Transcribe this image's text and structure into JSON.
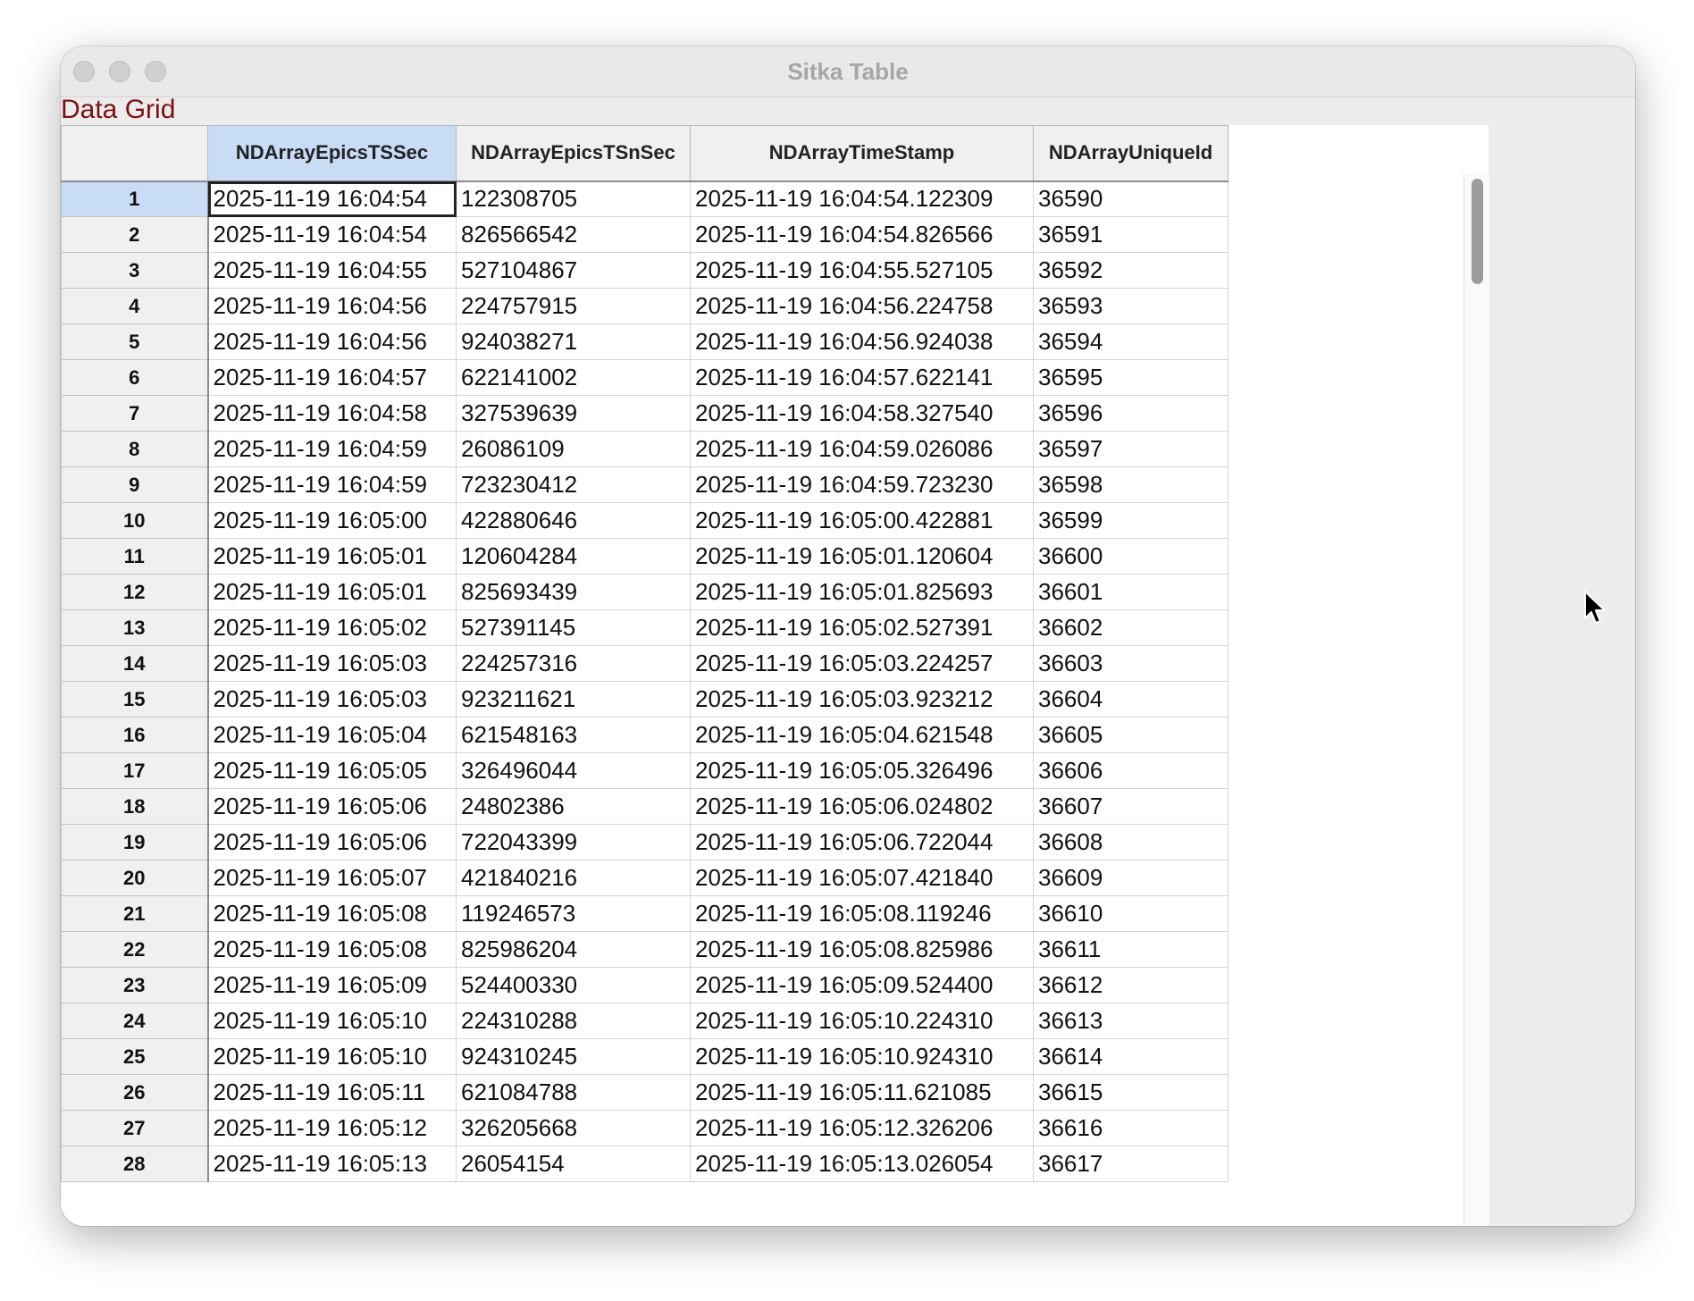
{
  "window": {
    "title": "Sitka Table"
  },
  "label": "Data Grid",
  "columns": [
    "NDArrayEpicsTSSec",
    "NDArrayEpicsTSnSec",
    "NDArrayTimeStamp",
    "NDArrayUniqueId"
  ],
  "rows": [
    [
      "1",
      "2025-11-19 16:04:54",
      "122308705",
      "2025-11-19 16:04:54.122309",
      "36590"
    ],
    [
      "2",
      "2025-11-19 16:04:54",
      "826566542",
      "2025-11-19 16:04:54.826566",
      "36591"
    ],
    [
      "3",
      "2025-11-19 16:04:55",
      "527104867",
      "2025-11-19 16:04:55.527105",
      "36592"
    ],
    [
      "4",
      "2025-11-19 16:04:56",
      "224757915",
      "2025-11-19 16:04:56.224758",
      "36593"
    ],
    [
      "5",
      "2025-11-19 16:04:56",
      "924038271",
      "2025-11-19 16:04:56.924038",
      "36594"
    ],
    [
      "6",
      "2025-11-19 16:04:57",
      "622141002",
      "2025-11-19 16:04:57.622141",
      "36595"
    ],
    [
      "7",
      "2025-11-19 16:04:58",
      "327539639",
      "2025-11-19 16:04:58.327540",
      "36596"
    ],
    [
      "8",
      "2025-11-19 16:04:59",
      "26086109",
      "2025-11-19 16:04:59.026086",
      "36597"
    ],
    [
      "9",
      "2025-11-19 16:04:59",
      "723230412",
      "2025-11-19 16:04:59.723230",
      "36598"
    ],
    [
      "10",
      "2025-11-19 16:05:00",
      "422880646",
      "2025-11-19 16:05:00.422881",
      "36599"
    ],
    [
      "11",
      "2025-11-19 16:05:01",
      "120604284",
      "2025-11-19 16:05:01.120604",
      "36600"
    ],
    [
      "12",
      "2025-11-19 16:05:01",
      "825693439",
      "2025-11-19 16:05:01.825693",
      "36601"
    ],
    [
      "13",
      "2025-11-19 16:05:02",
      "527391145",
      "2025-11-19 16:05:02.527391",
      "36602"
    ],
    [
      "14",
      "2025-11-19 16:05:03",
      "224257316",
      "2025-11-19 16:05:03.224257",
      "36603"
    ],
    [
      "15",
      "2025-11-19 16:05:03",
      "923211621",
      "2025-11-19 16:05:03.923212",
      "36604"
    ],
    [
      "16",
      "2025-11-19 16:05:04",
      "621548163",
      "2025-11-19 16:05:04.621548",
      "36605"
    ],
    [
      "17",
      "2025-11-19 16:05:05",
      "326496044",
      "2025-11-19 16:05:05.326496",
      "36606"
    ],
    [
      "18",
      "2025-11-19 16:05:06",
      "24802386",
      "2025-11-19 16:05:06.024802",
      "36607"
    ],
    [
      "19",
      "2025-11-19 16:05:06",
      "722043399",
      "2025-11-19 16:05:06.722044",
      "36608"
    ],
    [
      "20",
      "2025-11-19 16:05:07",
      "421840216",
      "2025-11-19 16:05:07.421840",
      "36609"
    ],
    [
      "21",
      "2025-11-19 16:05:08",
      "119246573",
      "2025-11-19 16:05:08.119246",
      "36610"
    ],
    [
      "22",
      "2025-11-19 16:05:08",
      "825986204",
      "2025-11-19 16:05:08.825986",
      "36611"
    ],
    [
      "23",
      "2025-11-19 16:05:09",
      "524400330",
      "2025-11-19 16:05:09.524400",
      "36612"
    ],
    [
      "24",
      "2025-11-19 16:05:10",
      "224310288",
      "2025-11-19 16:05:10.224310",
      "36613"
    ],
    [
      "25",
      "2025-11-19 16:05:10",
      "924310245",
      "2025-11-19 16:05:10.924310",
      "36614"
    ],
    [
      "26",
      "2025-11-19 16:05:11",
      "621084788",
      "2025-11-19 16:05:11.621085",
      "36615"
    ],
    [
      "27",
      "2025-11-19 16:05:12",
      "326205668",
      "2025-11-19 16:05:12.326206",
      "36616"
    ],
    [
      "28",
      "2025-11-19 16:05:13",
      "26054154",
      "2025-11-19 16:05:13.026054",
      "36617"
    ]
  ],
  "selection": {
    "row": 1,
    "column": "NDArrayEpicsTSSec"
  },
  "colors": {
    "selection": "#c9dcf5",
    "label": "#7d1010",
    "title": "#a6a6a6"
  }
}
